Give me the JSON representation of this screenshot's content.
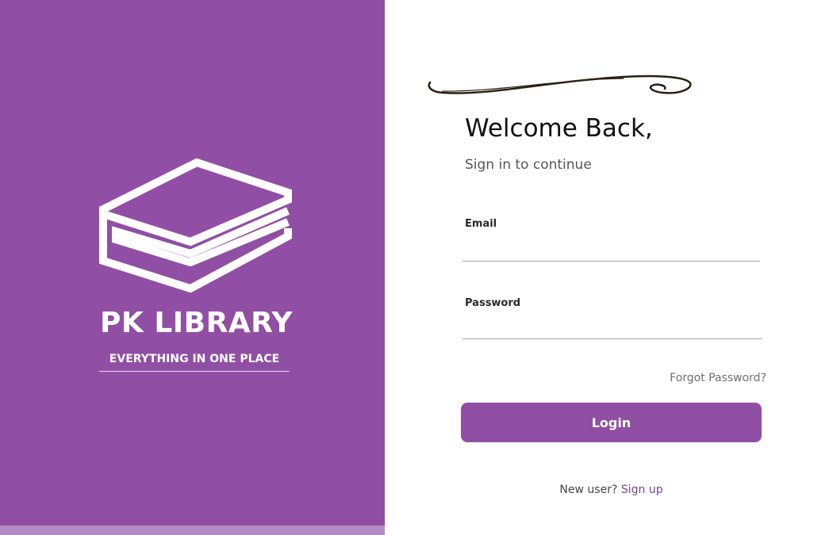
{
  "brand": {
    "name": "PK LIBRARY",
    "tagline": "EVERYTHING IN ONE PLACE",
    "logo_icon": "stacked-books-icon"
  },
  "form": {
    "title": "Welcome Back,",
    "subtitle": "Sign in to continue",
    "email_label": "Email",
    "email_value": "",
    "password_label": "Password",
    "password_value": "",
    "forgot_password": "Forgot Password?",
    "login_label": "Login",
    "new_user_text": "New user?",
    "signup_link": "Sign up"
  },
  "colors": {
    "brand_purple": "#904ea5",
    "panel_strip": "#b489c4",
    "link_purple": "#7b3f98",
    "swash": "#2b1e12"
  }
}
